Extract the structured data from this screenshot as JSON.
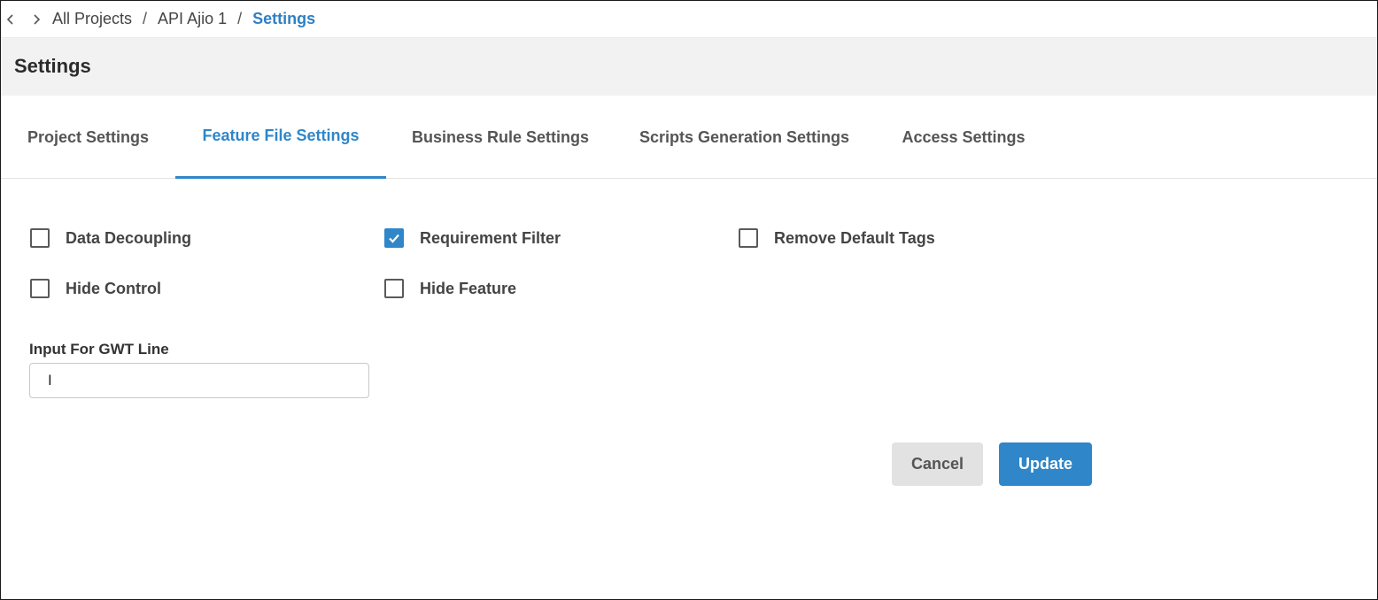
{
  "breadcrumb": {
    "items": [
      "All Projects",
      "API Ajio 1"
    ],
    "separator": "/",
    "current": "Settings"
  },
  "page": {
    "title": "Settings"
  },
  "tabs": [
    {
      "label": "Project Settings",
      "active": false
    },
    {
      "label": "Feature File Settings",
      "active": true
    },
    {
      "label": "Business Rule Settings",
      "active": false
    },
    {
      "label": "Scripts Generation Settings",
      "active": false
    },
    {
      "label": "Access Settings",
      "active": false
    }
  ],
  "options": {
    "data_decoupling": {
      "label": "Data Decoupling",
      "checked": false
    },
    "requirement_filter": {
      "label": "Requirement Filter",
      "checked": true
    },
    "remove_default_tags": {
      "label": "Remove Default Tags",
      "checked": false
    },
    "hide_control": {
      "label": "Hide Control",
      "checked": false
    },
    "hide_feature": {
      "label": "Hide Feature",
      "checked": false
    }
  },
  "gwt_input": {
    "label": "Input For GWT Line",
    "value": "I"
  },
  "actions": {
    "cancel_label": "Cancel",
    "update_label": "Update"
  },
  "colors": {
    "accent": "#2f86c9",
    "header_bg": "#f2f2f2",
    "cancel_bg": "#e2e2e2"
  },
  "icons": {
    "back": "chevron-left-icon",
    "forward": "chevron-right-icon",
    "check": "checkmark-icon"
  }
}
